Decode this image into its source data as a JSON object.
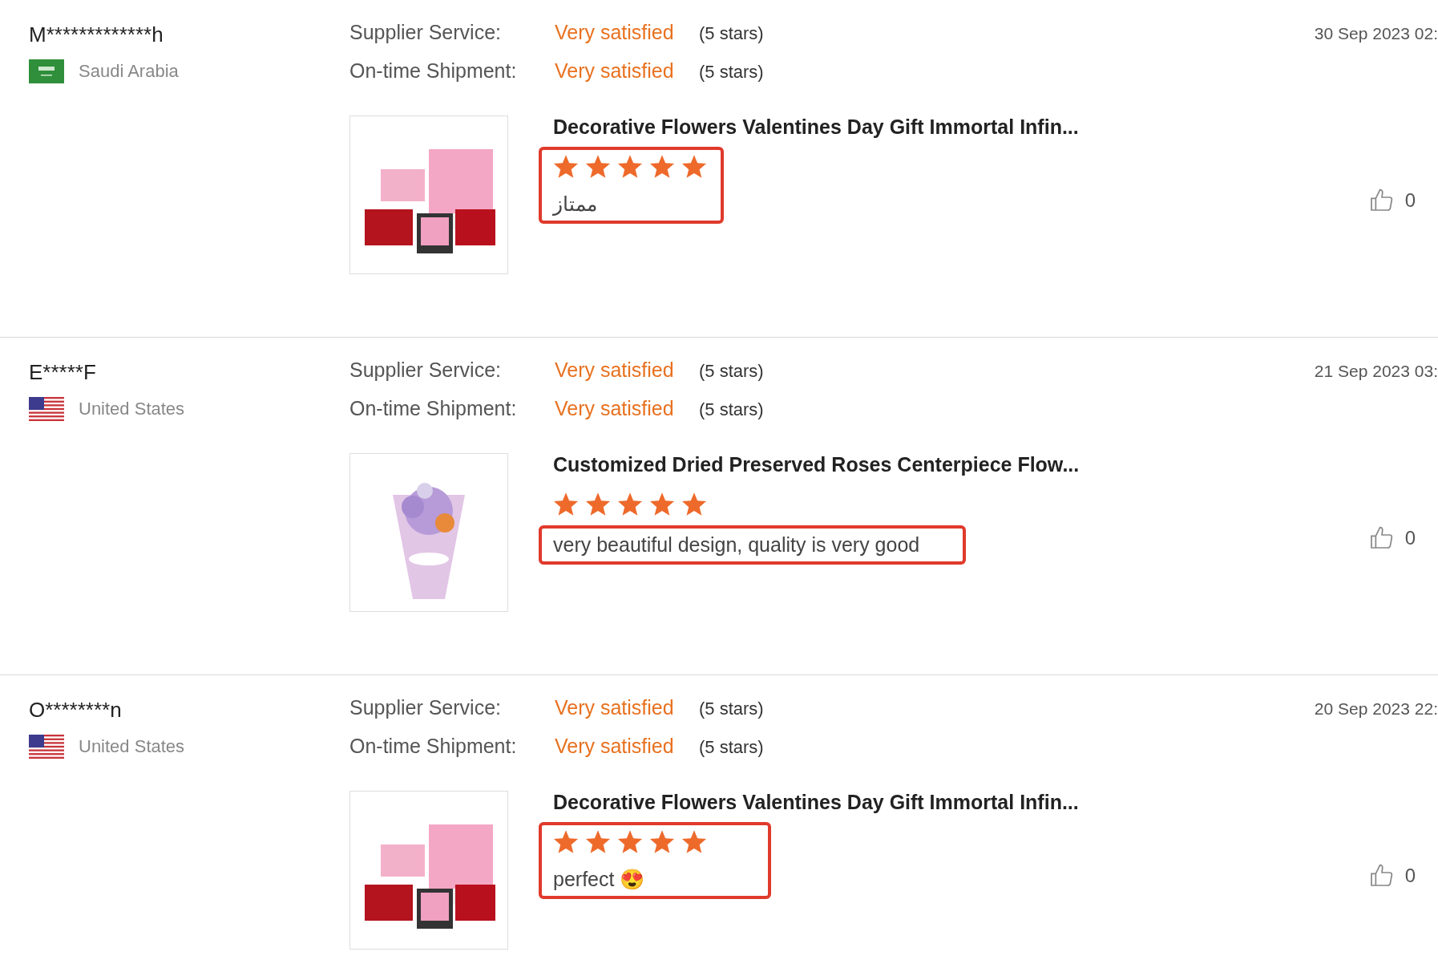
{
  "reviews": [
    {
      "reviewer": "M*************h",
      "flag": {
        "kind": "sa"
      },
      "country": "Saudi Arabia",
      "ratings": [
        {
          "label": "Supplier Service:",
          "value": "Very satisfied",
          "stars_text": "(5 stars)"
        },
        {
          "label": "On-time Shipment:",
          "value": "Very satisfied",
          "stars_text": "(5 stars)"
        }
      ],
      "date": "30 Sep 2023 02:",
      "product_title": "Decorative Flowers Valentines Day Gift Immortal Infin...",
      "photo": {
        "kind": "boxes"
      },
      "stars": 5,
      "comment": "ممتاز",
      "stars_highlighted": true,
      "comment_highlighted": true,
      "likes": "0"
    },
    {
      "reviewer": "E*****F",
      "flag": {
        "kind": "us"
      },
      "country": "United States",
      "ratings": [
        {
          "label": "Supplier Service:",
          "value": "Very satisfied",
          "stars_text": "(5 stars)"
        },
        {
          "label": "On-time Shipment:",
          "value": "Very satisfied",
          "stars_text": "(5 stars)"
        }
      ],
      "date": "21 Sep 2023 03:",
      "product_title": "Customized Dried Preserved Roses Centerpiece Flow...",
      "photo": {
        "kind": "bouquet"
      },
      "stars": 5,
      "comment": "very beautiful design, quality is very good",
      "stars_highlighted": false,
      "comment_highlighted": true,
      "likes": "0"
    },
    {
      "reviewer": "O********n",
      "flag": {
        "kind": "us"
      },
      "country": "United States",
      "ratings": [
        {
          "label": "Supplier Service:",
          "value": "Very satisfied",
          "stars_text": "(5 stars)"
        },
        {
          "label": "On-time Shipment:",
          "value": "Very satisfied",
          "stars_text": "(5 stars)"
        }
      ],
      "date": "20 Sep 2023 22:",
      "product_title": "Decorative Flowers Valentines Day Gift Immortal Infin...",
      "photo": {
        "kind": "boxes"
      },
      "stars": 5,
      "comment": "perfect 😍",
      "stars_highlighted": true,
      "comment_highlighted": true,
      "likes": "0"
    }
  ]
}
